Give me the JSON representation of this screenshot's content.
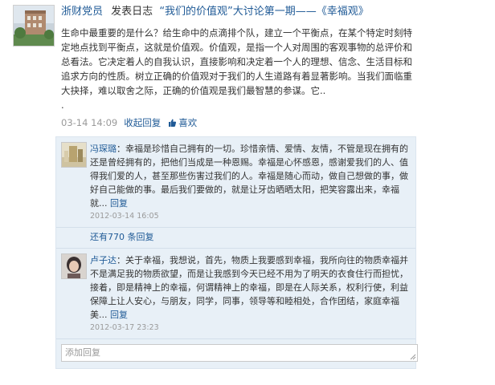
{
  "post": {
    "author": "浙财党员",
    "action": "发表日志",
    "topic": "“我们的价值观”大讨论第一期——《幸福观》",
    "body": "生命中最重要的是什么？给生命中的点滴排个队，建立一个平衡点，在某个特定时刻特定地点找到平衡点，这就是价值观。价值观，是指一个人对周围的客观事物的总评价和总看法。它决定着人的自我认识，直接影响和决定着一个人的理想、信念、生活目标和追求方向的性质。树立正确的价值观对于我们的人生道路有着显著影响。当我们面临重大抉择，难以取舍之际，正确的价值观是我们最智慧的参谋。它..",
    "dot": ".",
    "time": "03-14 14:09",
    "collect_reply": "收起回复",
    "like": "喜欢"
  },
  "comments": [
    {
      "name": "冯琛璐",
      "text": "：幸福是珍惜自己拥有的一切。珍惜亲情、爱情、友情，不管是现在拥有的还是曾经拥有的，把他们当成是一种恩赐。幸福是心怀感恩，感谢爱我们的人、值得我们爱的人，甚至那些伤害过我们的人。幸福是随心而动，做自己想做的事，做好自己能做的事。最后我们要做的，就是让牙齿晒晒太阳，把笑容露出来，幸福就...",
      "reply": "回复",
      "time": "2012-03-14 16:05"
    },
    {
      "name": "卢子达",
      "text": "：关于幸福，我想说，首先，物质上我要感到幸福，我所向往的物质幸福并不是满足我的物质欲望，而是让我感到今天已经不用为了明天的衣食住行而担忧，接着，即是精神上的幸福，何谓精神上的幸福，即是在人际关系，权利行使，利益保障上让人安心，与朋友，同学，同事，领导等和睦相处，合作团结，家庭幸福美...",
      "reply": "回复",
      "time": "2012-03-17 23:23"
    }
  ],
  "more_replies": "还有770 条回复",
  "reply_placeholder": "添加回复",
  "icons": {
    "like": "heart-thumb-icon",
    "resize": "resize-grip-icon"
  },
  "colors": {
    "link": "#1f5a96",
    "comment_bg": "#e8f0f7",
    "muted": "#9a9a9a"
  }
}
